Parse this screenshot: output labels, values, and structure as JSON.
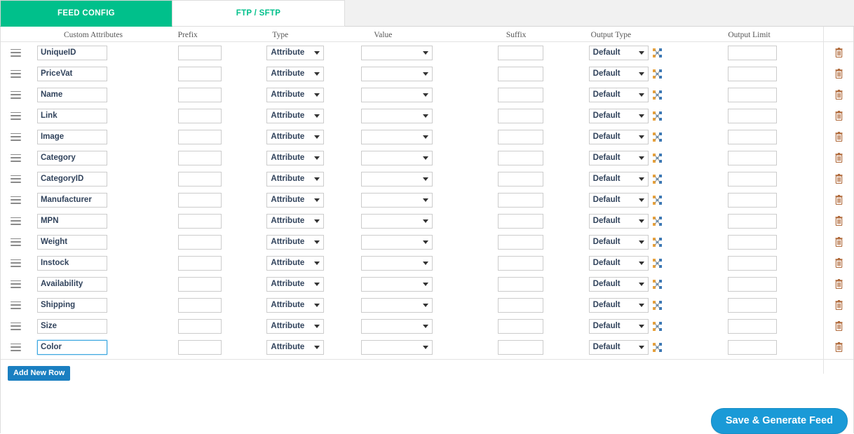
{
  "tabs": [
    {
      "label": "FEED CONFIG",
      "active": true
    },
    {
      "label": "FTP / SFTP",
      "active": false
    }
  ],
  "colors": {
    "tab_active_bg": "#00c08b",
    "tab_inactive_text": "#00c08b",
    "add_row_bg": "#1a7fc1",
    "save_bg": "#1a9ad7",
    "focus_border": "#3ba7e0"
  },
  "table": {
    "columns": [
      "Custom Attributes",
      "Prefix",
      "Type",
      "Value",
      "Suffix",
      "Output Type",
      "Output Limit"
    ],
    "rows": [
      {
        "attribute": "UniqueID",
        "prefix": "",
        "type": "Attribute",
        "value": "",
        "suffix": "",
        "output_type": "Default",
        "output_limit": "",
        "focused": false
      },
      {
        "attribute": "PriceVat",
        "prefix": "",
        "type": "Attribute",
        "value": "",
        "suffix": "",
        "output_type": "Default",
        "output_limit": "",
        "focused": false
      },
      {
        "attribute": "Name",
        "prefix": "",
        "type": "Attribute",
        "value": "",
        "suffix": "",
        "output_type": "Default",
        "output_limit": "",
        "focused": false
      },
      {
        "attribute": "Link",
        "prefix": "",
        "type": "Attribute",
        "value": "",
        "suffix": "",
        "output_type": "Default",
        "output_limit": "",
        "focused": false
      },
      {
        "attribute": "Image",
        "prefix": "",
        "type": "Attribute",
        "value": "",
        "suffix": "",
        "output_type": "Default",
        "output_limit": "",
        "focused": false
      },
      {
        "attribute": "Category",
        "prefix": "",
        "type": "Attribute",
        "value": "",
        "suffix": "",
        "output_type": "Default",
        "output_limit": "",
        "focused": false
      },
      {
        "attribute": "CategoryID",
        "prefix": "",
        "type": "Attribute",
        "value": "",
        "suffix": "",
        "output_type": "Default",
        "output_limit": "",
        "focused": false
      },
      {
        "attribute": "Manufacturer",
        "prefix": "",
        "type": "Attribute",
        "value": "",
        "suffix": "",
        "output_type": "Default",
        "output_limit": "",
        "focused": false
      },
      {
        "attribute": "MPN",
        "prefix": "",
        "type": "Attribute",
        "value": "",
        "suffix": "",
        "output_type": "Default",
        "output_limit": "",
        "focused": false
      },
      {
        "attribute": "Weight",
        "prefix": "",
        "type": "Attribute",
        "value": "",
        "suffix": "",
        "output_type": "Default",
        "output_limit": "",
        "focused": false
      },
      {
        "attribute": "Instock",
        "prefix": "",
        "type": "Attribute",
        "value": "",
        "suffix": "",
        "output_type": "Default",
        "output_limit": "",
        "focused": false
      },
      {
        "attribute": "Availability",
        "prefix": "",
        "type": "Attribute",
        "value": "",
        "suffix": "",
        "output_type": "Default",
        "output_limit": "",
        "focused": false
      },
      {
        "attribute": "Shipping",
        "prefix": "",
        "type": "Attribute",
        "value": "",
        "suffix": "",
        "output_type": "Default",
        "output_limit": "",
        "focused": false
      },
      {
        "attribute": "Size",
        "prefix": "",
        "type": "Attribute",
        "value": "",
        "suffix": "",
        "output_type": "Default",
        "output_limit": "",
        "focused": false
      },
      {
        "attribute": "Color",
        "prefix": "",
        "type": "Attribute",
        "value": "",
        "suffix": "",
        "output_type": "Default",
        "output_limit": "",
        "focused": true
      }
    ],
    "icons": {
      "drag": "drag-handle-icon",
      "map": "map-connector-icon",
      "delete": "trash-icon"
    }
  },
  "buttons": {
    "add_new_row": "Add New Row",
    "save_generate": "Save & Generate Feed"
  }
}
